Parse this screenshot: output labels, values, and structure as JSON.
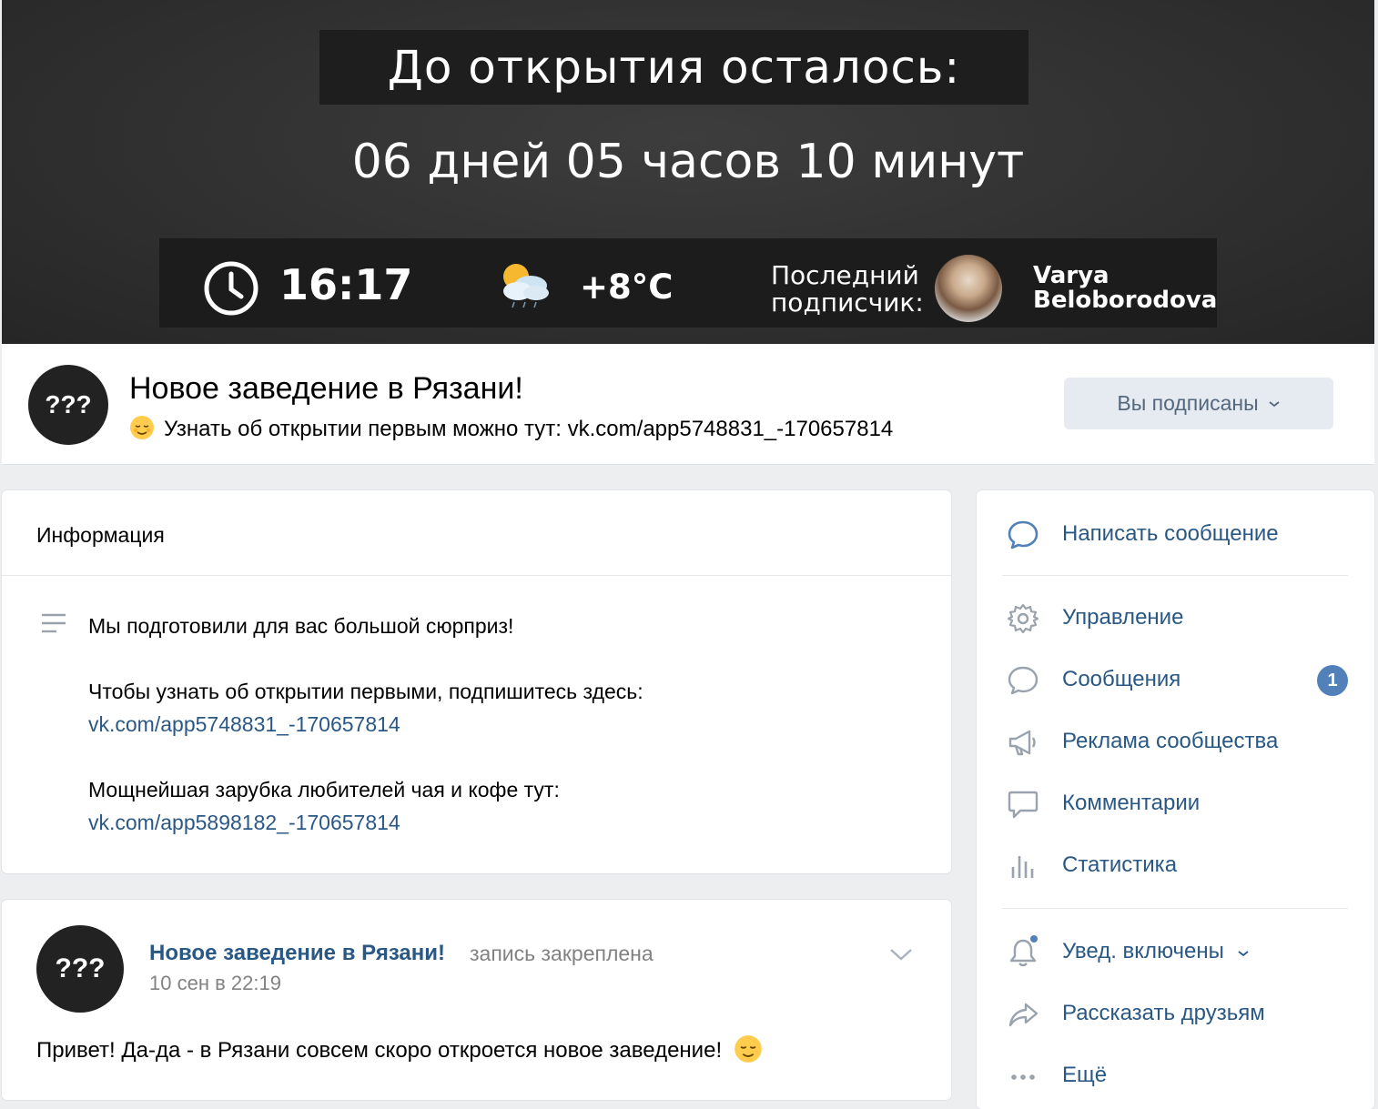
{
  "cover": {
    "title": "До открытия осталось:",
    "countdown": "06 дней 05 часов 10 минут",
    "time": "16:17",
    "temperature": "+8°C",
    "last_subscriber_label_line1": "Последний",
    "last_subscriber_label_line2": "подписчик:",
    "subscriber_first_name": "Varya",
    "subscriber_last_name": "Beloborodova"
  },
  "group": {
    "avatar_text": "???",
    "name": "Новое заведение в Рязани!",
    "status": "Узнать об открытии первым можно тут: vk.com/app5748831_-170657814",
    "subscribe_button": "Вы подписаны"
  },
  "info": {
    "title": "Информация",
    "line1": "Мы подготовили для вас большой сюрприз!",
    "line2": "Чтобы узнать об открытии первыми, подпишитесь здесь:",
    "link1": "vk.com/app5748831_-170657814",
    "line3": "Мощнейшая зарубка любителей чая и кофе тут:",
    "link2": "vk.com/app5898182_-170657814"
  },
  "post": {
    "avatar_text": "???",
    "author": "Новое заведение в Рязани!",
    "pinned_label": "запись закреплена",
    "date": "10 сен в 22:19",
    "text": "Привет! Да-да - в Рязани совсем скоро откроется новое заведение!"
  },
  "sidebar": {
    "write_message": "Написать сообщение",
    "items": [
      {
        "label": "Управление",
        "icon": "gear-icon"
      },
      {
        "label": "Сообщения",
        "icon": "chat-bubble-icon",
        "badge": "1"
      },
      {
        "label": "Реклама сообщества",
        "icon": "megaphone-icon"
      },
      {
        "label": "Комментарии",
        "icon": "comment-icon"
      },
      {
        "label": "Статистика",
        "icon": "stats-icon"
      }
    ],
    "notifications": "Увед. включены",
    "share": "Рассказать друзьям",
    "more": "Ещё"
  },
  "colors": {
    "link": "#2a5885",
    "badge": "#5181b8",
    "button_bg": "#e5ebf1",
    "page_bg": "#edeef0"
  }
}
